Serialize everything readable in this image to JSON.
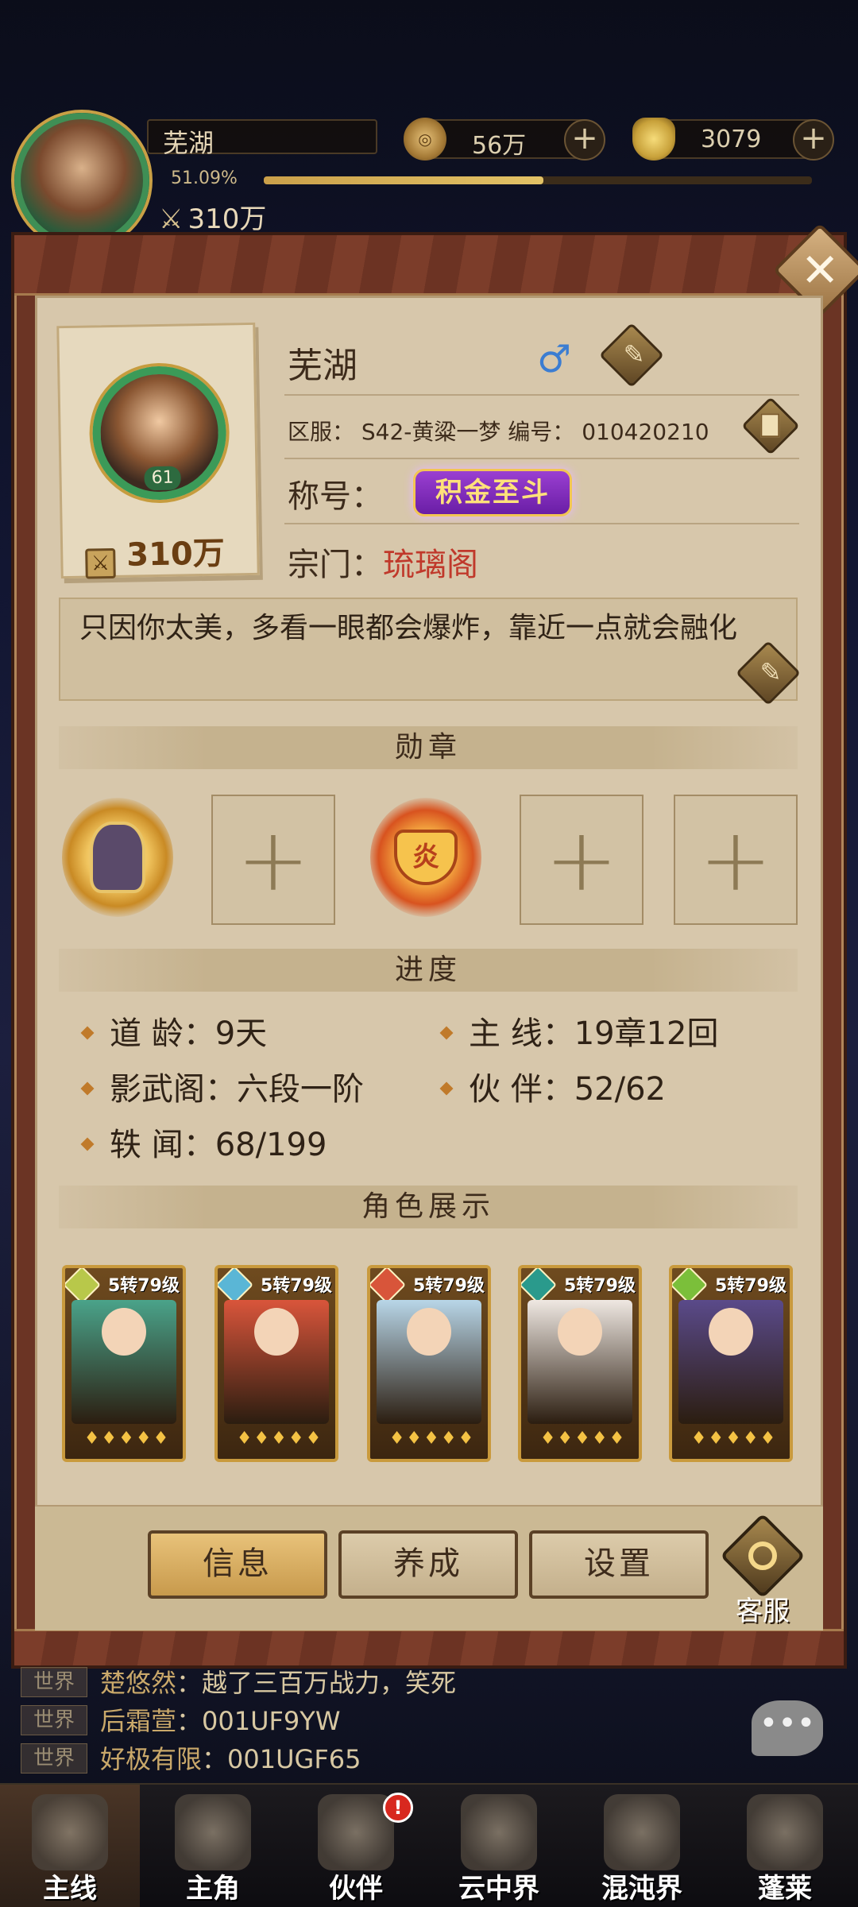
{
  "hud": {
    "player_name": "芜湖",
    "exp_percent": "51.09%",
    "exp_fill": 0.51,
    "power": "310万",
    "coins": "56万",
    "gold": "3079"
  },
  "profile": {
    "name": "芜湖",
    "gender_symbol": "♂",
    "level": "61",
    "power": "310万",
    "server_line": "区服： S42-黄粱一梦 编号： 010420210",
    "title_label": "称号：",
    "title_badge": "积金至斗",
    "sect_label": "宗门：",
    "sect_value": "琉璃阁",
    "signature": "只因你太美，多看一眼都会爆炸，靠近一点就会融化"
  },
  "sections": {
    "medals": "勋章",
    "progress": "进度",
    "roles": "角色展示"
  },
  "progress": {
    "dao_age": "道 龄：9天",
    "main_line": "主 线：19章12回",
    "shadow_pavilion": "影武阁：六段一阶",
    "partners": "伙 伴：52/62",
    "anecdotes": "轶 闻：68/199"
  },
  "heroes": [
    {
      "level": "5转79级",
      "element_color": "#b8c84a",
      "art_color": "#4aa38a"
    },
    {
      "level": "5转79级",
      "element_color": "#5ab6d6",
      "art_color": "#d9553b"
    },
    {
      "level": "5转79级",
      "element_color": "#d8553a",
      "art_color": "#b8d6e8"
    },
    {
      "level": "5转79级",
      "element_color": "#2a9a8c",
      "art_color": "#efe8e2"
    },
    {
      "level": "5转79级",
      "element_color": "#7bbf3a",
      "art_color": "#5a4a8a"
    }
  ],
  "buttons": {
    "info": "信息",
    "cultivate": "养成",
    "settings": "设置",
    "service": "客服"
  },
  "chat": [
    {
      "tag": "世界",
      "name": "楚悠然",
      "text": "：越了三百万战力，笑死"
    },
    {
      "tag": "世界",
      "name": "后霜萱",
      "text": "：001UF9YW"
    },
    {
      "tag": "世界",
      "name": "好极有限",
      "text": "：001UGF65"
    }
  ],
  "nav": [
    {
      "label": "主线",
      "active": true
    },
    {
      "label": "主角",
      "active": false
    },
    {
      "label": "伙伴",
      "active": false
    },
    {
      "label": "云中界",
      "active": false
    },
    {
      "label": "混沌界",
      "active": false
    },
    {
      "label": "蓬莱",
      "active": false
    }
  ],
  "nav_badge": "!"
}
